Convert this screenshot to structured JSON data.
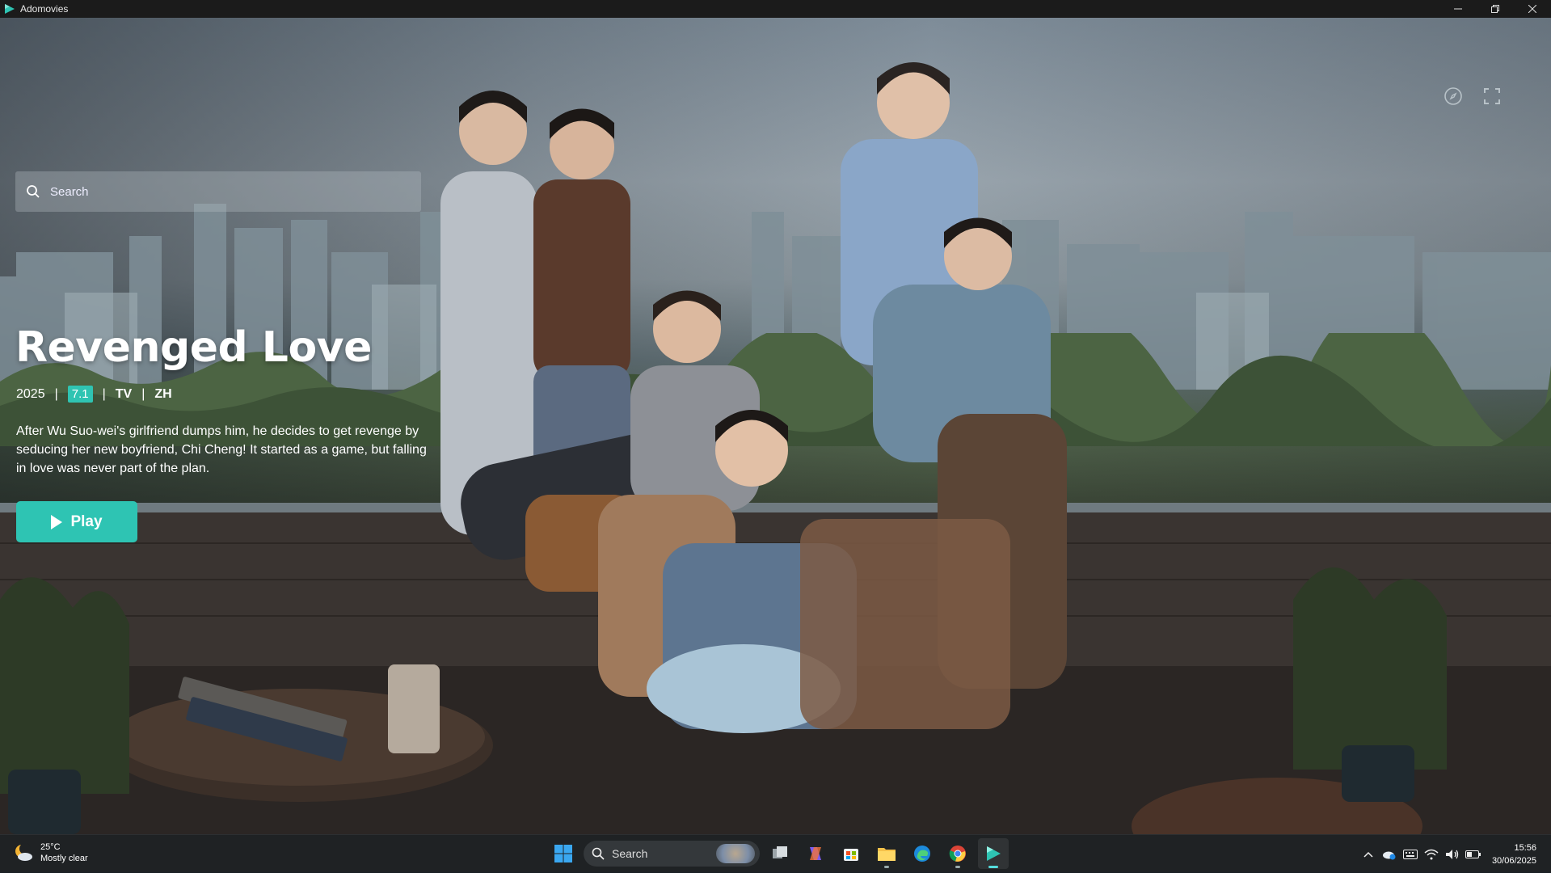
{
  "window": {
    "title": "Adomovies",
    "icon": "play-triangle-icon"
  },
  "top_icons": [
    "compass-icon",
    "fullscreen-icon"
  ],
  "search": {
    "placeholder": "Search",
    "value": ""
  },
  "featured": {
    "title": "Revenged Love",
    "year": "2025",
    "rating": "7.1",
    "type": "TV",
    "language": "ZH",
    "separator": "|",
    "description": "After Wu Suo-wei's girlfriend dumps him, he decides to get revenge by seducing her new boyfriend, Chi Cheng! It started as a game, but falling in love was never part of the plan.",
    "play_label": "Play"
  },
  "colors": {
    "accent": "#2ec4b3",
    "titlebar": "#1b1b1b",
    "taskbar": "#1f2224"
  },
  "taskbar": {
    "weather": {
      "temp": "25°C",
      "condition": "Mostly clear"
    },
    "search_label": "Search",
    "apps": [
      "windows-start-icon",
      "search",
      "task-view-icon",
      "copilot-icon",
      "microsoft-store-icon",
      "file-explorer-icon",
      "edge-icon",
      "chrome-icon",
      "adomovies-icon"
    ],
    "tray": [
      "chevron-up-icon",
      "onedrive-icon",
      "keyboard-icon",
      "wifi-icon",
      "volume-icon",
      "battery-icon"
    ],
    "clock": {
      "time": "15:56",
      "date": "30/06/2025"
    }
  }
}
